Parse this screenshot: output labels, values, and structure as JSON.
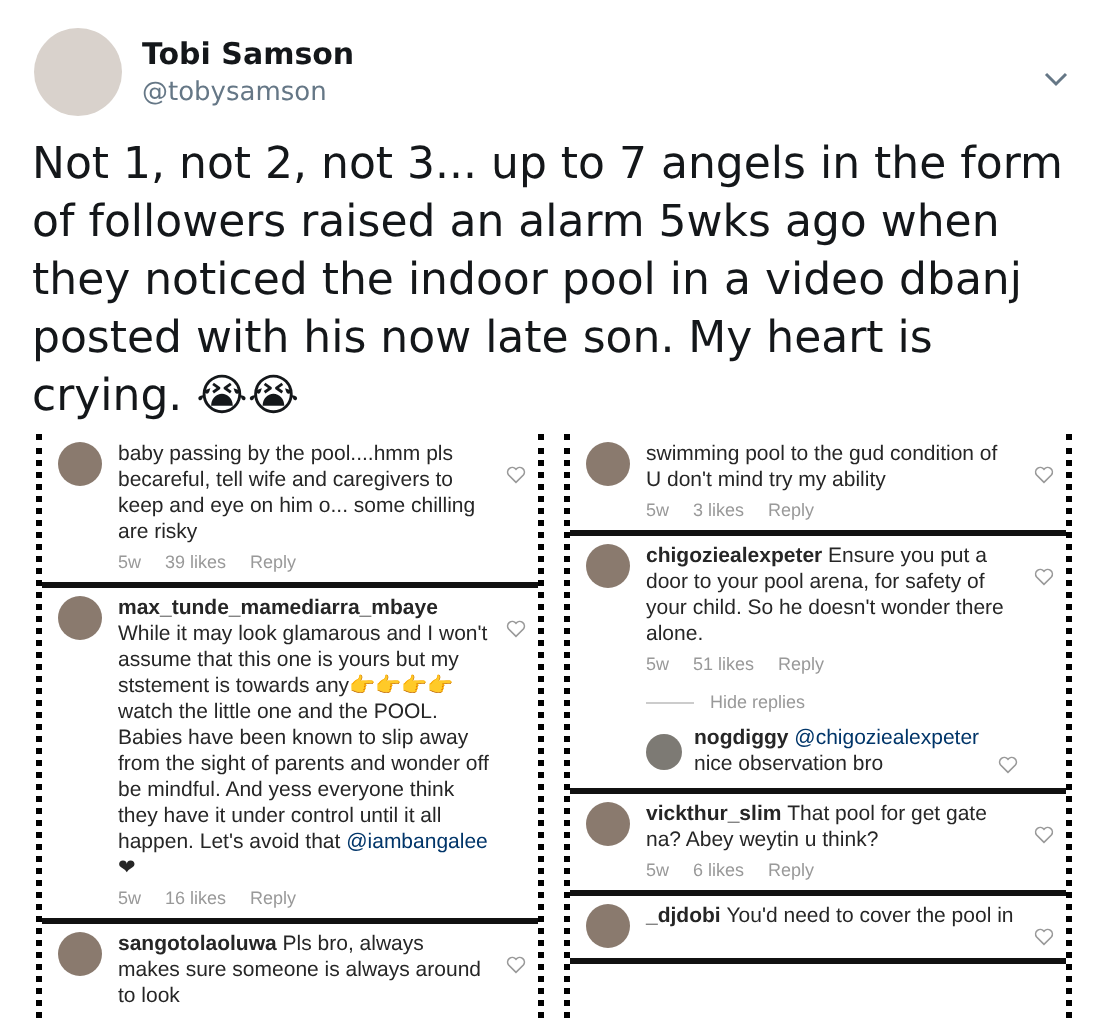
{
  "tweet": {
    "name": "Tobi Samson",
    "handle": "@tobysamson",
    "text": "Not 1, not 2, not 3... up to 7 angels in the form of followers raised an alarm 5wks ago when they noticed the indoor pool in a video dbanj posted with his now late son. My heart is crying. 😭😭"
  },
  "columns": [
    {
      "comments": [
        {
          "text": "baby passing by the pool....hmm pls becareful, tell wife and caregivers to keep and eye on him o... some chilling are risky",
          "time": "5w",
          "likes": "39 likes",
          "reply": "Reply"
        },
        {
          "user": "max_tunde_mamediarra_mbaye",
          "text": "While it may look glamarous and I won't assume that this one is yours but my ststement is towards any👉👉👉👉 watch the little one and the POOL. Babies have been known to slip away from the sight of parents and wonder off be mindful. And yess everyone think they have it under control until it all happen. Let's avoid that",
          "mention": "@iambangalee",
          "tail": "❤",
          "time": "5w",
          "likes": "16 likes",
          "reply": "Reply"
        },
        {
          "user": "sangotolaoluwa",
          "text": "Pls bro, always makes sure someone is always around to look"
        }
      ]
    },
    {
      "comments": [
        {
          "text": "swimming pool to the gud condition of U don't mind try my ability",
          "time": "5w",
          "likes": "3 likes",
          "reply": "Reply"
        },
        {
          "user": "chigoziealexpeter",
          "text": "Ensure you put a door to your pool arena, for safety of your child. So he doesn't wonder there alone.",
          "time": "5w",
          "likes": "51 likes",
          "reply": "Reply",
          "hide_replies": "Hide replies",
          "replies": [
            {
              "user": "nogdiggy",
              "mention": "@chigoziealexpeter",
              "text": "nice observation bro"
            }
          ]
        },
        {
          "user": "vickthur_slim",
          "text": "That pool for get gate na? Abey weytin u think?",
          "time": "5w",
          "likes": "6 likes",
          "reply": "Reply"
        },
        {
          "user": "_djdobi",
          "text": "You'd need to cover the pool in"
        }
      ]
    }
  ]
}
